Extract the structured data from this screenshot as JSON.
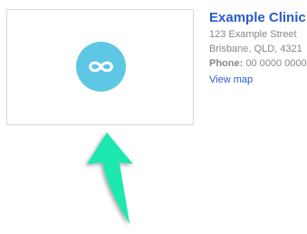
{
  "clinic": {
    "logo_icon": "infinity-icon",
    "logo_color": "#5ec7e3",
    "name": "Example Clinic",
    "name_color": "#2a5bc8",
    "address_line1": "123 Example Street",
    "address_line2": "Brisbane, QLD, 4321",
    "phone_label": "Phone:",
    "phone_value": "00 0000 0000",
    "view_map_label": "View map",
    "link_color": "#2a5bc8",
    "text_color": "#888888"
  },
  "annotation": {
    "arrow_icon": "up-arrow-icon",
    "arrow_color": "#1de8b0"
  }
}
